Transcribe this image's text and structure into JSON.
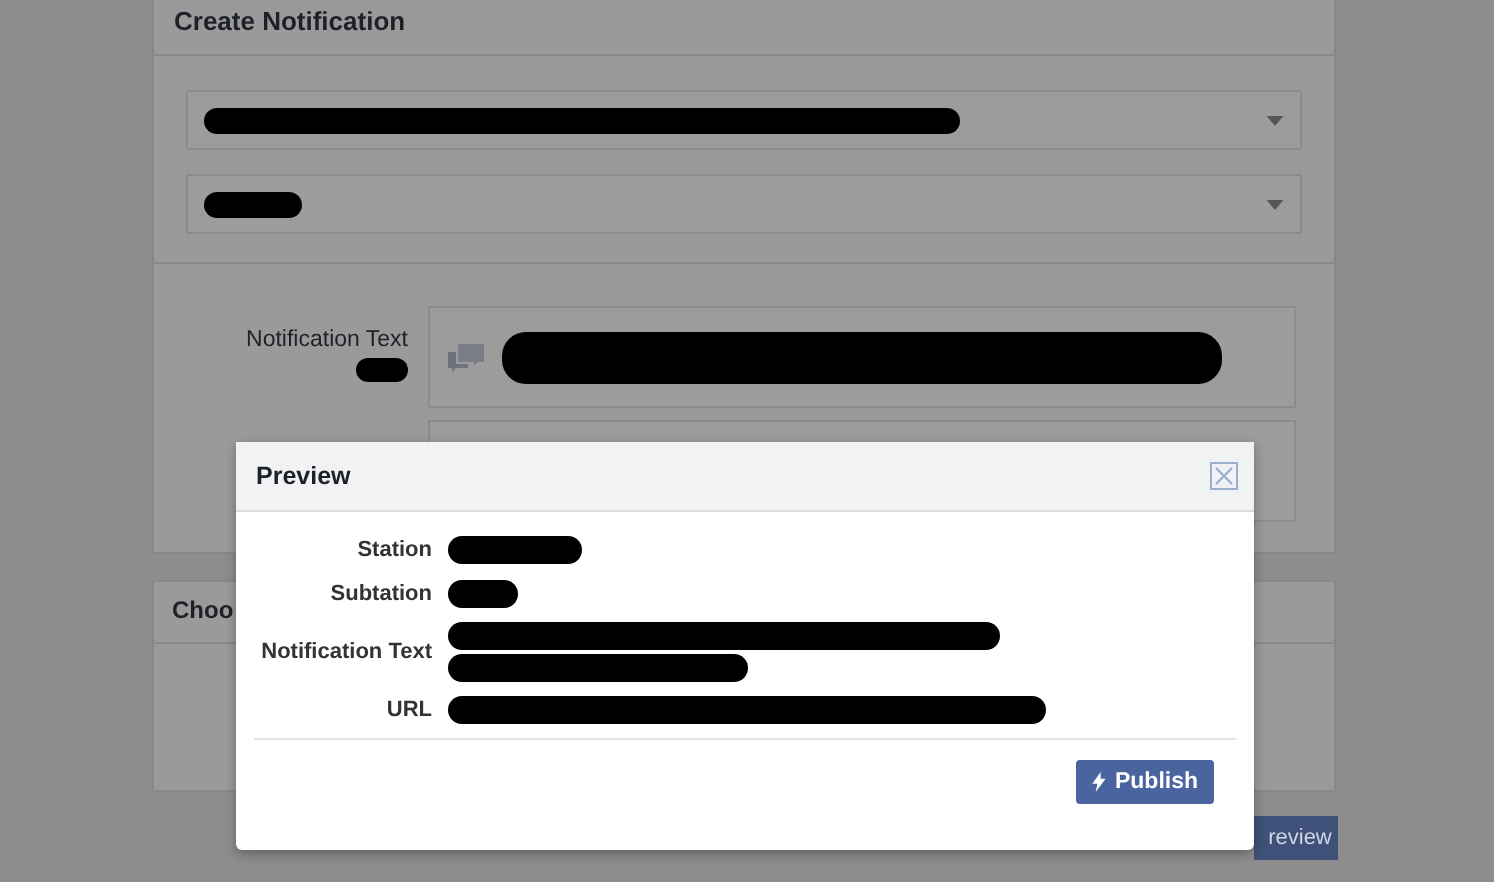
{
  "create_panel": {
    "title": "Create Notification",
    "dropdowns": [
      {
        "redacted": true
      },
      {
        "redacted": true
      }
    ],
    "fields": [
      {
        "label": "Notification Text",
        "label_redacted": true,
        "value_redacted": true
      },
      {
        "label_redacted": false,
        "value_redacted": false
      }
    ]
  },
  "choose_panel": {
    "title": "Choo"
  },
  "preview_button": {
    "label": "review"
  },
  "modal": {
    "title": "Preview",
    "rows": [
      {
        "label": "Station",
        "redacted": true
      },
      {
        "label": "Subtation",
        "redacted": true
      },
      {
        "label": "Notification Text",
        "redacted": true
      },
      {
        "label": "URL",
        "redacted": true
      }
    ],
    "publish": {
      "label": "Publish"
    }
  }
}
